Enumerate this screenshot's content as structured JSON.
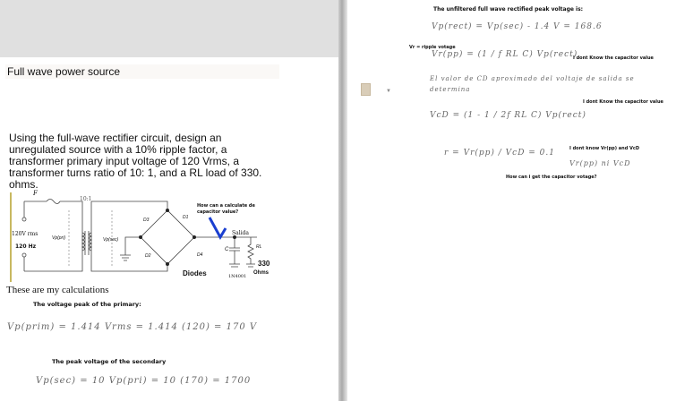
{
  "left_page": {
    "title": "Full wave power source",
    "question": "Using the full-wave rectifier circuit, design an unregulated source with a 10% ripple factor, a transformer primary input voltage of 120 Vrms, a transformer turns ratio of 10: 1, and a RL load of 330.",
    "question_end": "ohms.",
    "diagram": {
      "fuse": "F",
      "ratio": "10:1",
      "input": "120V rms",
      "freq": "120 Hz",
      "vp_pri": "Vp(pri)",
      "vp_sec": "Vp(sec)",
      "d1": "D1",
      "d2": "D2",
      "d3": "D3",
      "d4": "D4",
      "cap": "C",
      "out": "Salida",
      "rl": "RL",
      "note": "How can a calculate de capacitor value?",
      "diodes": "Diodes",
      "diode_model": "1N4001",
      "load_value": "330",
      "load_unit": "Ohms"
    },
    "calc_heading": "These are my calculations",
    "primary_heading": "The voltage peak of the primary:",
    "primary_eq": "Vp(prim) = 1.414 Vrms = 1.414 (120) = 170 V",
    "secondary_heading": "The peak voltage of the secondary",
    "secondary_eq": "Vp(sec) = 10 Vp(pri) = 10 (170) = 1700"
  },
  "right_page": {
    "heading": "The unfiltered full wave rectified peak voltage is:",
    "eq1": "Vp(rect) = Vp(sec) - 1.4 V = 168.6",
    "ripple_label": "Vr = ripple votage",
    "eq2": "Vr(pp) = (1 / f RL C) Vp(rect)",
    "note1": "I dont Know the capacitor value",
    "spanish": "El valor de CD aproximado del voltaje de salida se determina",
    "note2": "I dont Know the capacitor value",
    "eq3": "VcD = (1 - 1 / 2f RL C) Vp(rect)",
    "eq4": "r = Vr(pp) / VcD = 0.1",
    "note3": "I dont know Vr(pp)  and VcD",
    "eq4b": "Vr(pp)  ni  VcD",
    "question": "How can i get the capacitor votage?"
  },
  "icons": {
    "doc": "document-icon",
    "dropdown": "chevron-down-icon"
  }
}
